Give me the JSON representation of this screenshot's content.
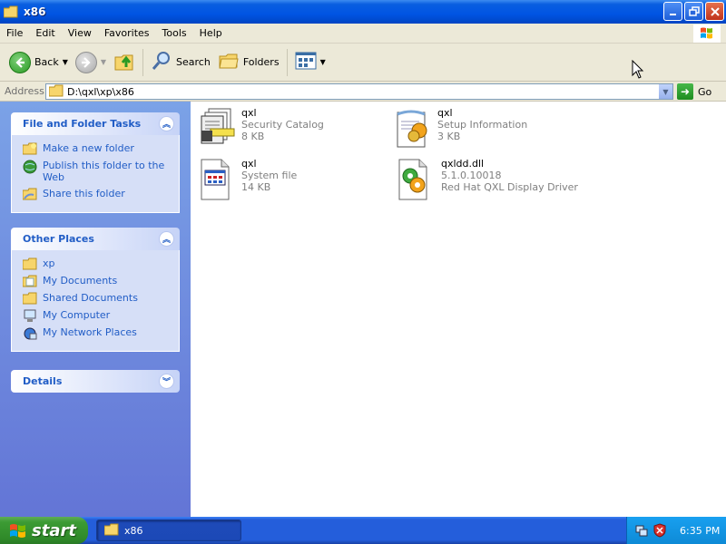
{
  "window": {
    "title": "x86"
  },
  "menu": {
    "items": [
      "File",
      "Edit",
      "View",
      "Favorites",
      "Tools",
      "Help"
    ]
  },
  "toolbar": {
    "back_label": "Back",
    "search_label": "Search",
    "folders_label": "Folders"
  },
  "address": {
    "label": "Address",
    "value": "D:\\qxl\\xp\\x86",
    "go_label": "Go"
  },
  "tasks": {
    "file_tasks": {
      "title": "File and Folder Tasks",
      "items": [
        "Make a new folder",
        "Publish this folder to the Web",
        "Share this folder"
      ]
    },
    "other_places": {
      "title": "Other Places",
      "items": [
        "xp",
        "My Documents",
        "Shared Documents",
        "My Computer",
        "My Network Places"
      ]
    },
    "details": {
      "title": "Details"
    }
  },
  "files": [
    {
      "name": "qxl",
      "line2": "Security Catalog",
      "line3": "8 KB",
      "icon": "security-catalog-icon"
    },
    {
      "name": "qxl",
      "line2": "Setup Information",
      "line3": "3 KB",
      "icon": "setup-information-icon"
    },
    {
      "name": "qxl",
      "line2": "System file",
      "line3": "14 KB",
      "icon": "system-file-icon"
    },
    {
      "name": "qxldd.dll",
      "line2": "5.1.0.10018",
      "line3": "Red Hat QXL Display Driver",
      "icon": "dll-file-icon"
    }
  ],
  "taskbar": {
    "start_label": "start",
    "window_button": "x86",
    "clock": "6:35 PM"
  },
  "colors": {
    "titlebar": "#0054e3",
    "taskpane": "#7ba2e7",
    "link": "#215dc6",
    "start": "#3c9b34"
  }
}
